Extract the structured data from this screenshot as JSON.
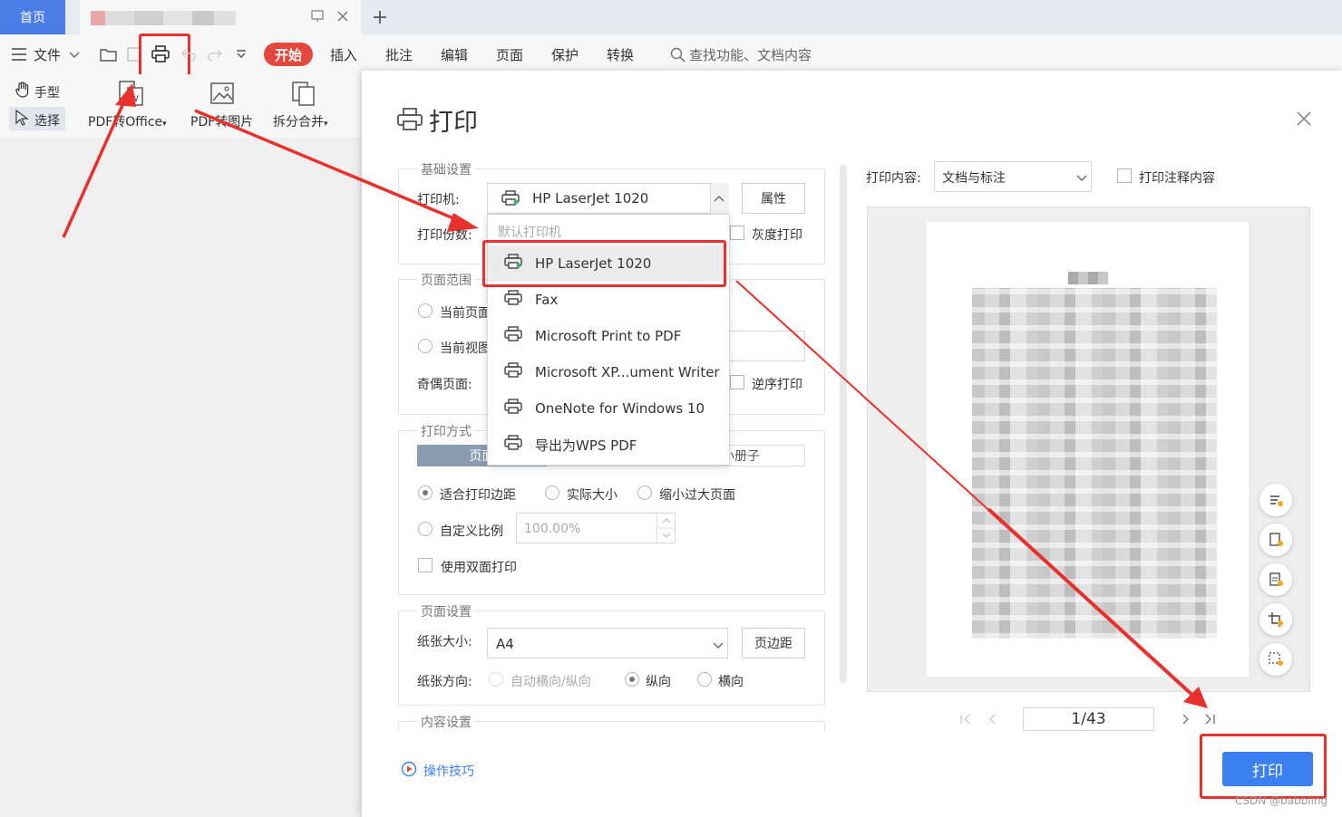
{
  "app": {
    "tab_home": "首页",
    "menu": {
      "file": "文件",
      "start": "开始",
      "insert": "插入",
      "annotate": "批注",
      "edit": "编辑",
      "page": "页面",
      "protect": "保护",
      "convert": "转换",
      "search": "查找功能、文档内容"
    },
    "tools": {
      "hand": "手型",
      "select": "选择",
      "pdf_to_office": "PDF转Office",
      "pdf_to_image": "PDF转图片",
      "split_merge": "拆分合并"
    }
  },
  "dialog": {
    "title": "打印",
    "basic": {
      "legend": "基础设置",
      "printer_label": "打印机:",
      "printer_value": "HP LaserJet 1020",
      "properties": "属性",
      "copies_label": "打印份数:",
      "grayscale": "灰度打印"
    },
    "printer_dropdown": {
      "header": "默认打印机",
      "items": [
        "HP LaserJet 1020",
        "Fax",
        "Microsoft Print to PDF",
        "Microsoft XP...ument Writer",
        "OneNote for Windows 10",
        "导出为WPS PDF"
      ]
    },
    "range": {
      "legend": "页面范围",
      "current_page": "当前页面",
      "current_view": "当前视图",
      "odd_even_label": "奇偶页面:",
      "reverse": "逆序打印"
    },
    "mode": {
      "legend": "打印方式",
      "tab_page": "页面",
      "tab_booklet": "小册子",
      "fit_margin": "适合打印边距",
      "actual_size": "实际大小",
      "shrink_large": "缩小过大页面",
      "custom_scale": "自定义比例",
      "scale_value": "100.00%",
      "duplex": "使用双面打印"
    },
    "page_setup": {
      "legend": "页面设置",
      "paper_label": "纸张大小:",
      "paper_value": "A4",
      "margin_btn": "页边距",
      "orient_label": "纸张方向:",
      "auto": "自动横向/纵向",
      "portrait": "纵向",
      "landscape": "横向"
    },
    "content_legend": "内容设置",
    "tips": "操作技巧",
    "print_content_label": "打印内容:",
    "print_content_value": "文档与标注",
    "print_annotations": "打印注释内容",
    "page_indicator": "1/43",
    "print_button": "打印"
  },
  "watermark": "CSDN @babbling",
  "colors": {
    "accent_blue": "#3c7ff0",
    "start_red": "#e4483d",
    "highlight_red": "#e8312d"
  }
}
